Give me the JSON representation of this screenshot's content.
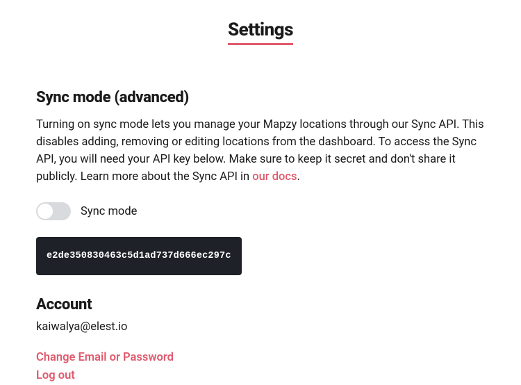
{
  "page": {
    "title": "Settings"
  },
  "sync": {
    "heading": "Sync mode (advanced)",
    "description_before_link": "Turning on sync mode lets you manage your Mapzy locations through our Sync API. This disables adding, removing or editing locations from the dashboard. To access the Sync API, you will need your API key below. Make sure to keep it secret and don't share it publicly. Learn more about the Sync API in ",
    "docs_link_text": "our docs",
    "description_after_link": ".",
    "toggle_label": "Sync mode",
    "toggle_on": false,
    "api_key": "e2de350830463c5d1ad737d666ec297c"
  },
  "account": {
    "heading": "Account",
    "email": "kaiwalya@elest.io",
    "change_link": "Change Email or Password",
    "logout_link": "Log out"
  },
  "colors": {
    "accent": "#e05a6d",
    "dark_box": "#1e2128",
    "toggle_bg": "#d8dadd"
  }
}
